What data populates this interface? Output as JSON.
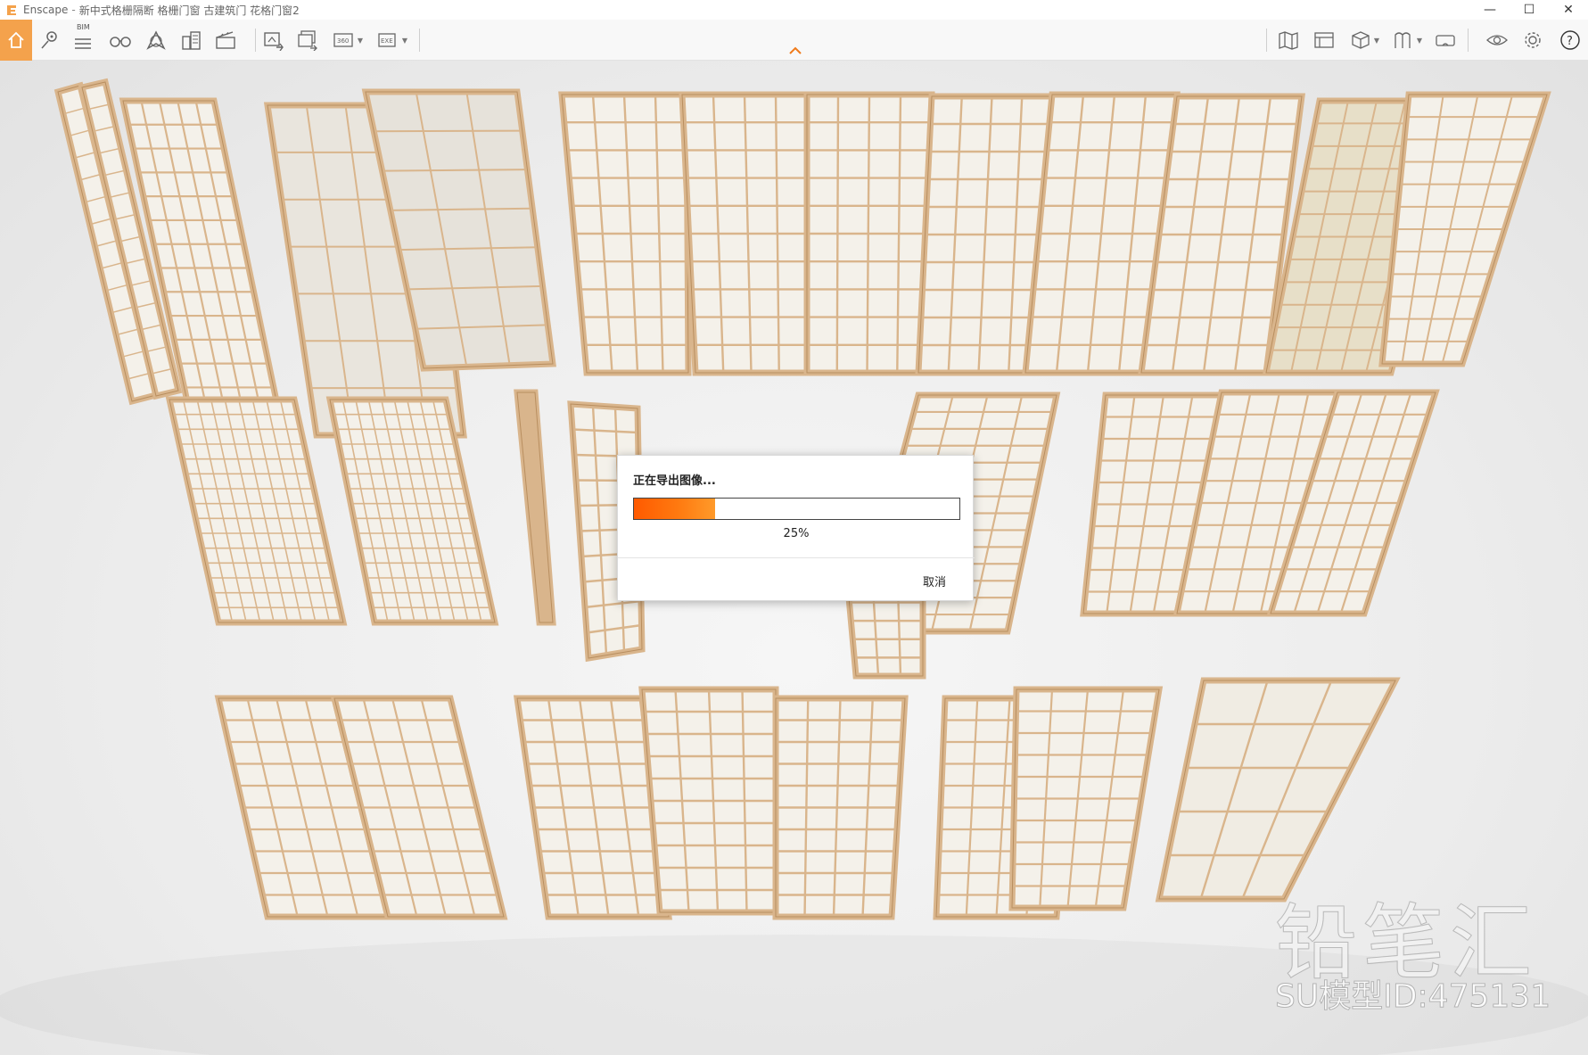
{
  "window": {
    "app_name": "Enscape",
    "title_separator": "-",
    "document_title": "新中式格栅隔断 格栅门窗 古建筑门 花格门窗2",
    "minimize_glyph": "—",
    "maximize_glyph": "☐",
    "close_glyph": "✕"
  },
  "toolbar": {
    "bim_label": "BIM",
    "help_glyph": "?",
    "icons": [
      "home-icon",
      "location-pin-icon",
      "bim-list-icon",
      "binoculars-icon",
      "navigation-icon",
      "buildings-icon",
      "clapperboard-icon",
      "screenshot-icon",
      "batch-render-icon",
      "panorama-360-icon",
      "exe-export-icon",
      "map-icon",
      "material-editor-icon",
      "box-view-icon",
      "asset-library-icon",
      "vr-headset-icon",
      "visibility-icon",
      "settings-icon",
      "help-icon"
    ],
    "accent_color": "#f4a24c"
  },
  "dialog": {
    "title": "正在导出图像...",
    "progress_percent": 25,
    "progress_label": "25%",
    "cancel_label": "取消",
    "progress_color": "#ff6a00"
  },
  "watermark": {
    "brand": "铅笔汇",
    "model_id": "SU模型ID:475131"
  },
  "colors": {
    "wood": "#d9b58c",
    "wood_dark": "#b88e5f",
    "paper": "#f4f1ea",
    "background": "#eeeeee"
  }
}
